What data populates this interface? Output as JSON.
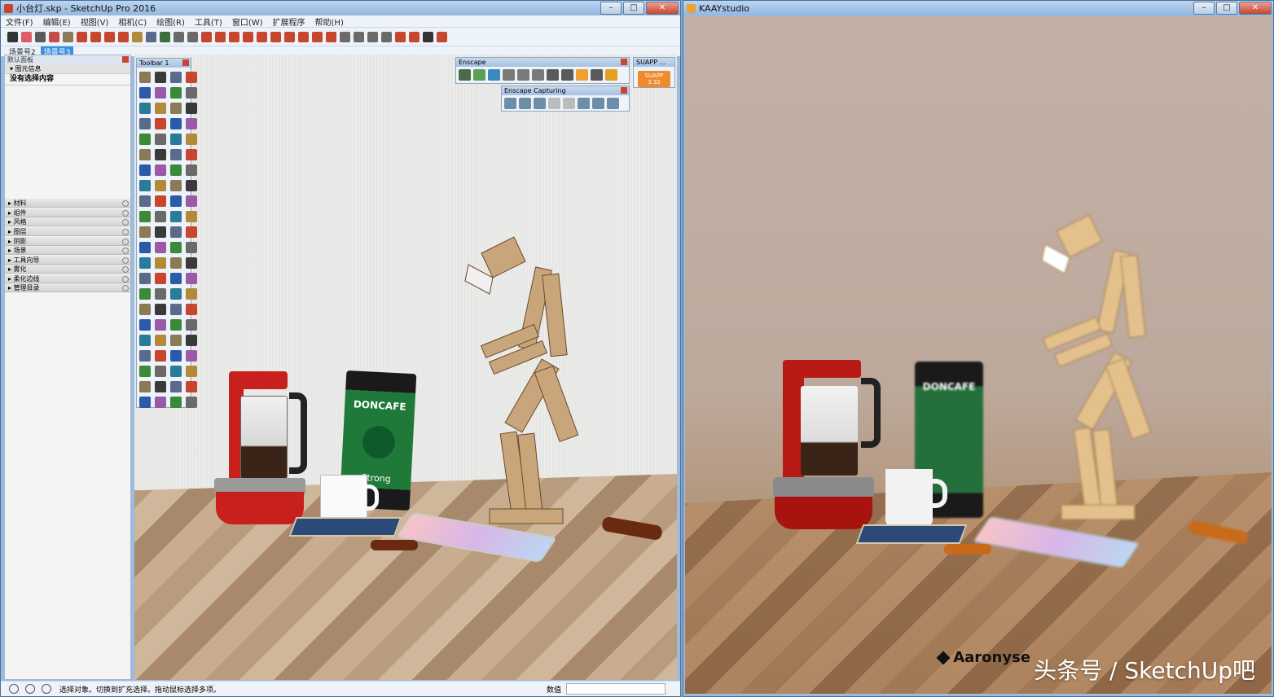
{
  "sketchup": {
    "title": "小台灯.skp - SketchUp Pro 2016",
    "menus": [
      "文件(F)",
      "编辑(E)",
      "视图(V)",
      "相机(C)",
      "绘图(R)",
      "工具(T)",
      "窗口(W)",
      "扩展程序",
      "帮助(H)"
    ],
    "scene_tabs": [
      "场景号2",
      "场景号3"
    ],
    "tray": {
      "header": "默认面板",
      "entity_info": "图元信息",
      "no_selection": "没有选择内容",
      "panels": [
        "材料",
        "组件",
        "风格",
        "图层",
        "阴影",
        "场景",
        "工具向导",
        "雾化",
        "柔化边线",
        "管理目录"
      ]
    },
    "toolbar1_title": "Toolbar 1",
    "enscape_title": "Enscape",
    "enscape_capturing_title": "Enscape Capturing",
    "suapp_title": "SUAPP ...",
    "suapp_button": "SUAPP 3.32",
    "status_text": "选择对象。切换到扩充选择。拖动鼠标选择多项。",
    "measure_label": "数值"
  },
  "kaay": {
    "title": "KAAYstudio",
    "signature": "Aaronyse",
    "watermark": "头条号 / SketchUp吧"
  },
  "products": {
    "coffee_brand": "DONCAFE",
    "coffee_variant": "Strong"
  },
  "colors": {
    "accent_blue": "#3b8fe0",
    "close_red": "#c8452e",
    "suapp_orange": "#f08a2c",
    "machine_red": "#c8201c"
  }
}
